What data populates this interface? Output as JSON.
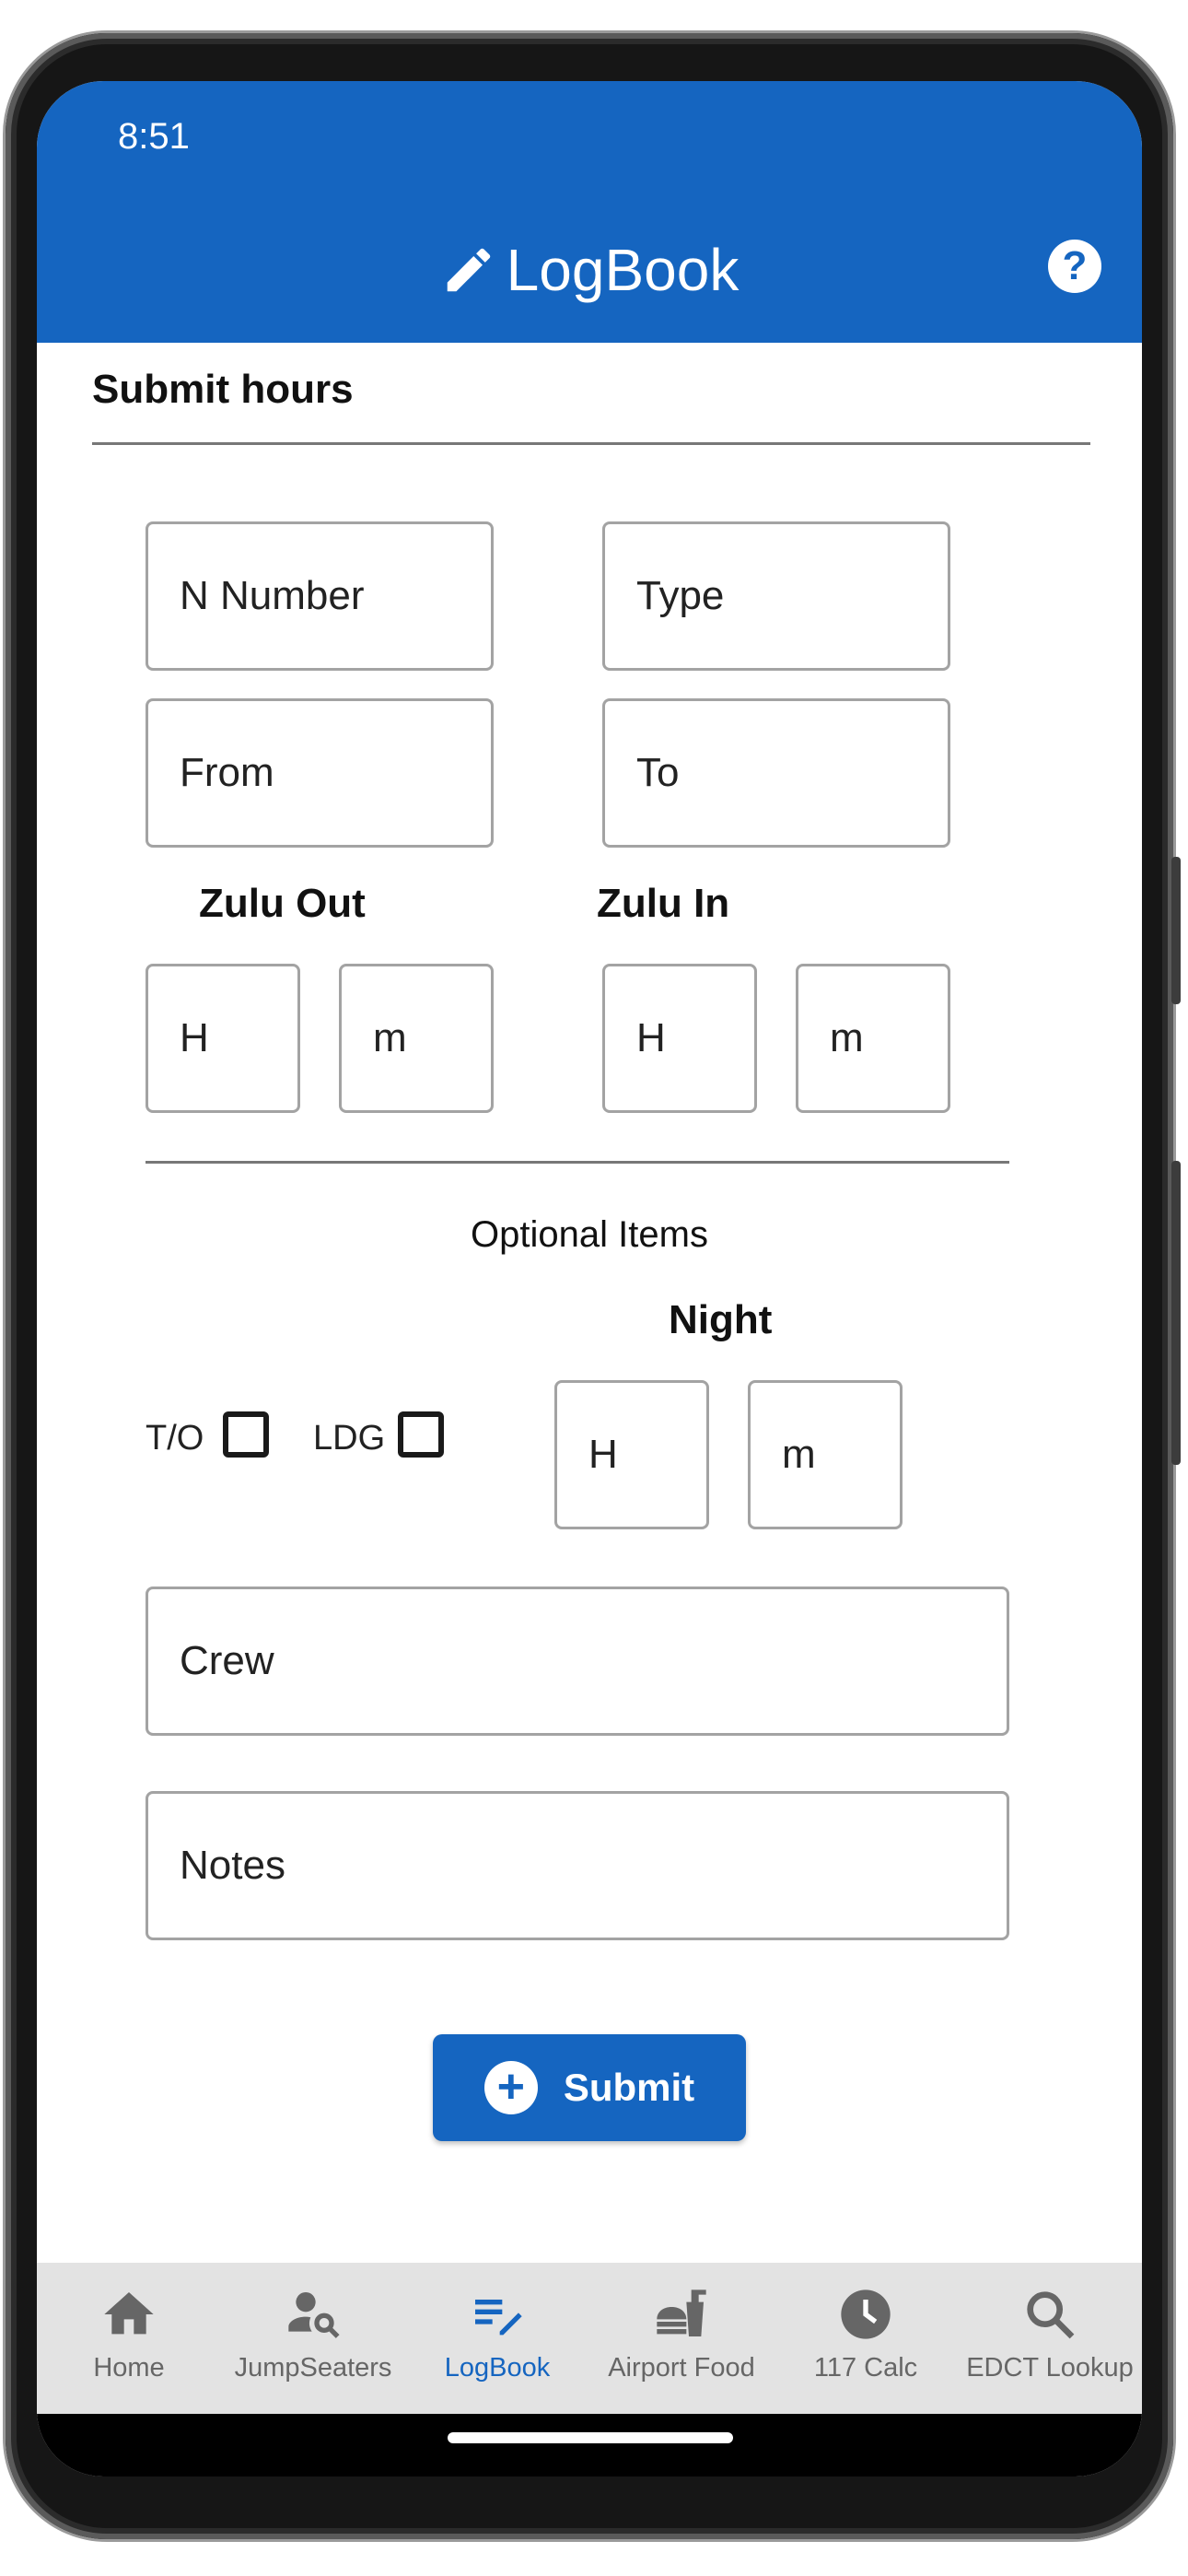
{
  "status_bar": {
    "time": "8:51"
  },
  "app_bar": {
    "title": "LogBook",
    "title_icon": "pencil-icon",
    "help_icon": "help-circle-icon"
  },
  "form": {
    "section_title": "Submit hours",
    "n_number_placeholder": "N Number",
    "type_placeholder": "Type",
    "from_placeholder": "From",
    "to_placeholder": "To",
    "zulu_out_label": "Zulu Out",
    "zulu_in_label": "Zulu In",
    "hour_placeholder": "H",
    "minute_placeholder": "m",
    "optional_label": "Optional Items",
    "night_label": "Night",
    "takeoff_label": "T/O",
    "landing_label": "LDG",
    "crew_placeholder": "Crew",
    "notes_placeholder": "Notes",
    "submit_label": "Submit"
  },
  "bottom_nav": {
    "items": [
      {
        "label": "Home",
        "icon": "home-icon",
        "active": false
      },
      {
        "label": "JumpSeaters",
        "icon": "person-search-icon",
        "active": false
      },
      {
        "label": "LogBook",
        "icon": "edit-note-icon",
        "active": true
      },
      {
        "label": "Airport Food",
        "icon": "fastfood-icon",
        "active": false
      },
      {
        "label": "117 Calc",
        "icon": "clock-icon",
        "active": false
      },
      {
        "label": "EDCT Lookup",
        "icon": "search-icon",
        "active": false
      }
    ]
  },
  "colors": {
    "primary": "#1565c0",
    "nav_background": "#e3e3e3",
    "field_border": "#a3a3a3",
    "inactive_nav": "#666666"
  }
}
